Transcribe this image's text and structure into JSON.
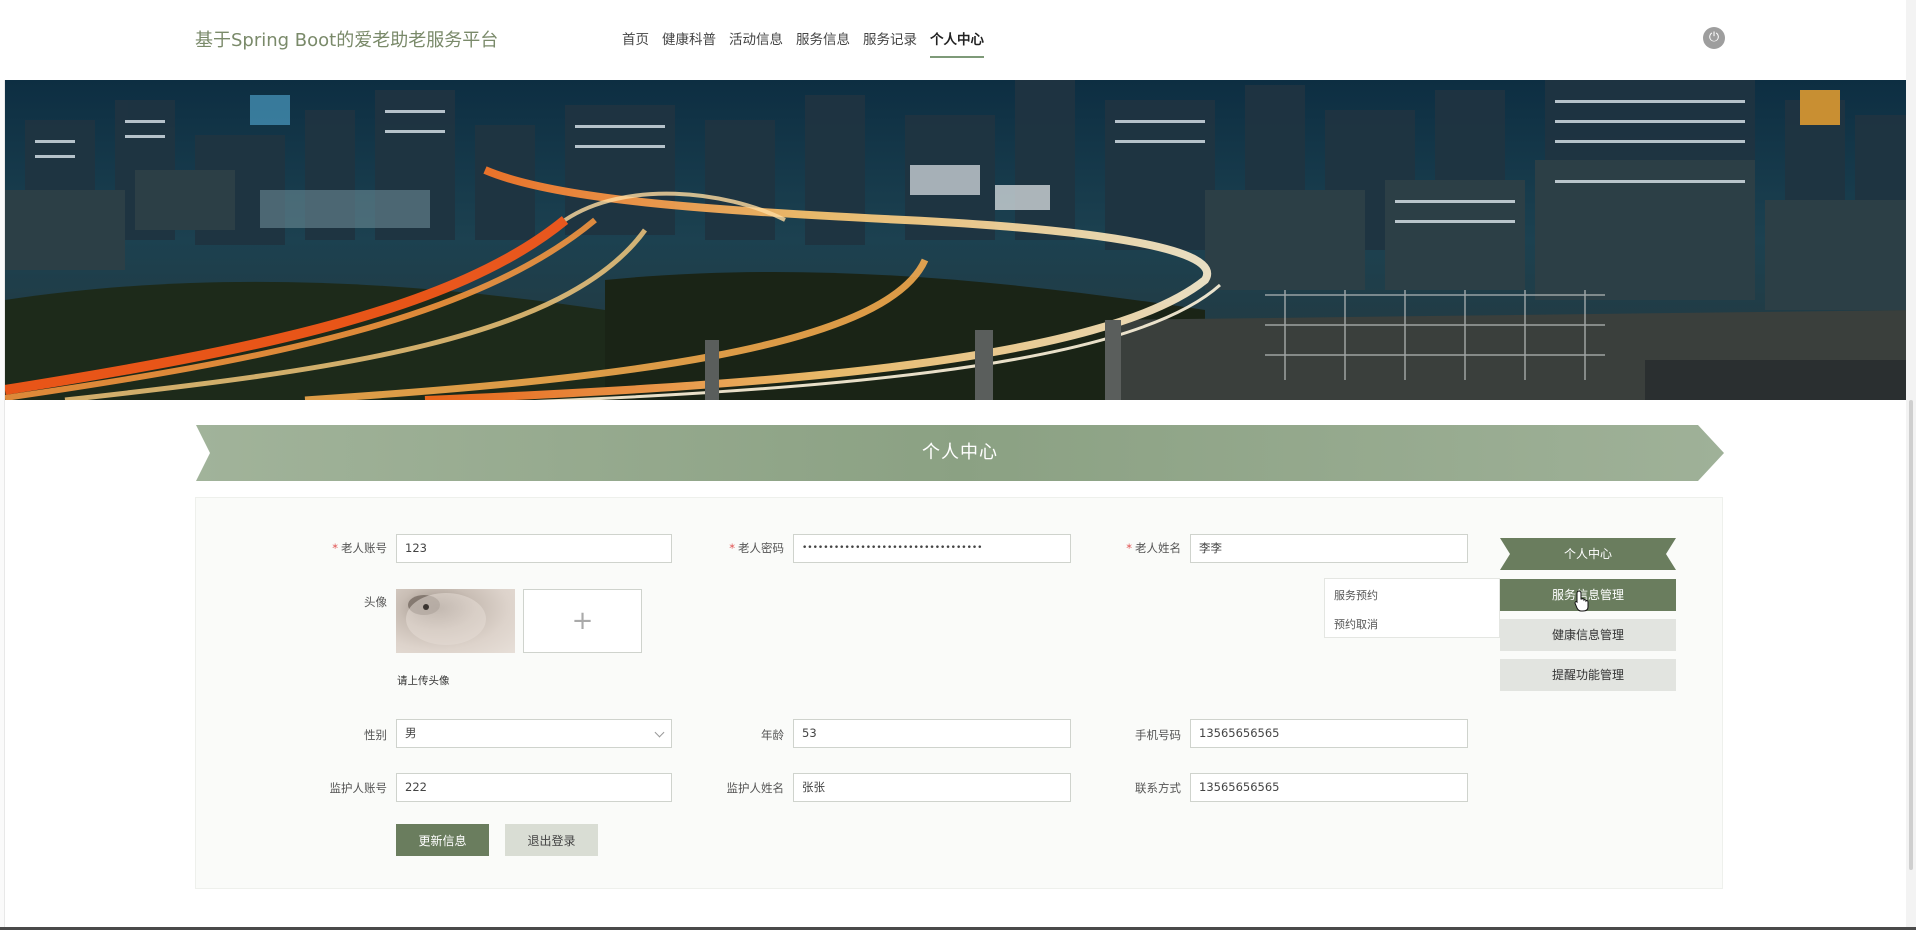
{
  "header": {
    "brand": "基于Spring Boot的爱老助老服务平台",
    "nav": [
      "首页",
      "健康科普",
      "活动信息",
      "服务信息",
      "服务记录",
      "个人中心"
    ],
    "active_nav": "个人中心",
    "power_icon": "power-icon"
  },
  "section": {
    "title": "个人中心"
  },
  "form": {
    "account_label": "老人账号",
    "account_value": "123",
    "password_label": "老人密码",
    "password_value": "••••••••••••••••••••••••••••••••••",
    "name_label": "老人姓名",
    "name_value": "李李",
    "avatar_label": "头像",
    "avatar_plus": "+",
    "avatar_hint": "请上传头像",
    "gender_label": "性别",
    "gender_value": "男",
    "age_label": "年龄",
    "age_value": "53",
    "phone_label": "手机号码",
    "phone_value": "13565656565",
    "guardian_account_label": "监护人账号",
    "guardian_account_value": "222",
    "guardian_name_label": "监护人姓名",
    "guardian_name_value": "张张",
    "contact_label": "联系方式",
    "contact_value": "13565656565",
    "required_mark": "*"
  },
  "buttons": {
    "update": "更新信息",
    "logout": "退出登录"
  },
  "sidebar": {
    "head": "个人中心",
    "items": [
      "服务信息管理",
      "健康信息管理",
      "提醒功能管理"
    ]
  },
  "dropdown": {
    "items": [
      "服务预约",
      "预约取消"
    ]
  },
  "colors": {
    "accent": "#6a7d5e",
    "ribbon": "#8fa486",
    "brand": "#7a8a6a"
  }
}
